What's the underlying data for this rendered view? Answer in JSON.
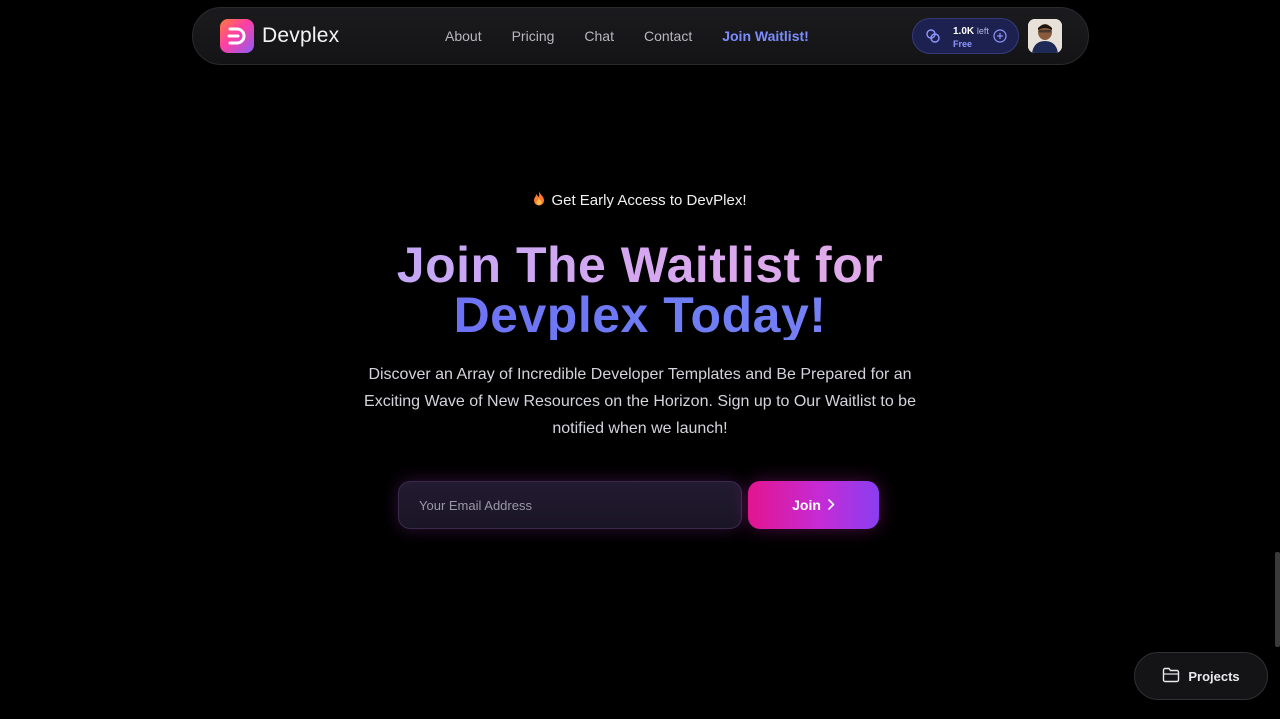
{
  "nav": {
    "brand": "Devplex",
    "links": [
      "About",
      "Pricing",
      "Chat",
      "Contact"
    ],
    "cta": "Join Waitlist!",
    "credits": {
      "amount": "1.0K",
      "suffix": "left",
      "tier": "Free"
    }
  },
  "hero": {
    "eyebrow": "Get Early Access to DevPlex!",
    "headline_line1": "Join The Waitlist for",
    "headline_line2": "Devplex Today!",
    "subtitle": "Discover an Array of Incredible Developer Templates and Be Prepared for an Exciting Wave of New Resources on the Horizon. Sign up to Our Waitlist to be notified when we launch!"
  },
  "form": {
    "email_placeholder": "Your Email Address",
    "email_value": "",
    "join_label": "Join"
  },
  "floating": {
    "projects_label": "Projects"
  },
  "colors": {
    "accent": "#7c8cff",
    "cta_gradient_start": "#e3148f",
    "cta_gradient_end": "#8a3ef0"
  }
}
